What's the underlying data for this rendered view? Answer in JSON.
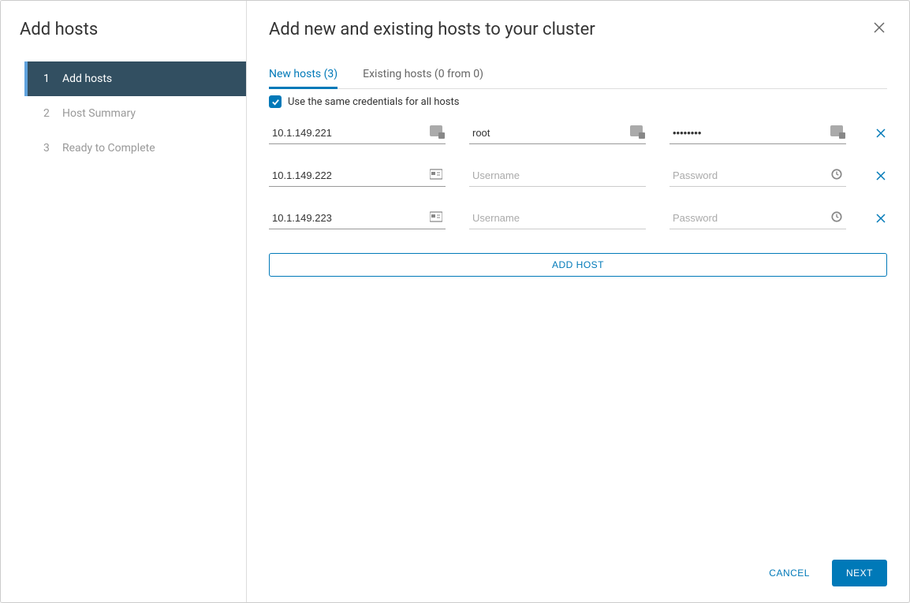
{
  "sidebar": {
    "title": "Add hosts",
    "steps": [
      {
        "num": "1",
        "label": "Add hosts",
        "active": true
      },
      {
        "num": "2",
        "label": "Host Summary",
        "active": false
      },
      {
        "num": "3",
        "label": "Ready to Complete",
        "active": false
      }
    ]
  },
  "main": {
    "title": "Add new and existing hosts to your cluster",
    "tabs": {
      "new_hosts": "New hosts (3)",
      "existing_hosts": "Existing hosts (0 from 0)"
    },
    "checkbox_label": "Use the same credentials for all hosts",
    "checkbox_checked": true,
    "placeholders": {
      "username": "Username",
      "password": "Password"
    },
    "hosts": [
      {
        "ip": "10.1.149.221",
        "username": "root",
        "password": "••••••••",
        "disabled": false
      },
      {
        "ip": "10.1.149.222",
        "username": "",
        "password": "",
        "disabled": true
      },
      {
        "ip": "10.1.149.223",
        "username": "",
        "password": "",
        "disabled": true
      }
    ],
    "add_host_label": "ADD HOST"
  },
  "footer": {
    "cancel": "CANCEL",
    "next": "NEXT"
  }
}
